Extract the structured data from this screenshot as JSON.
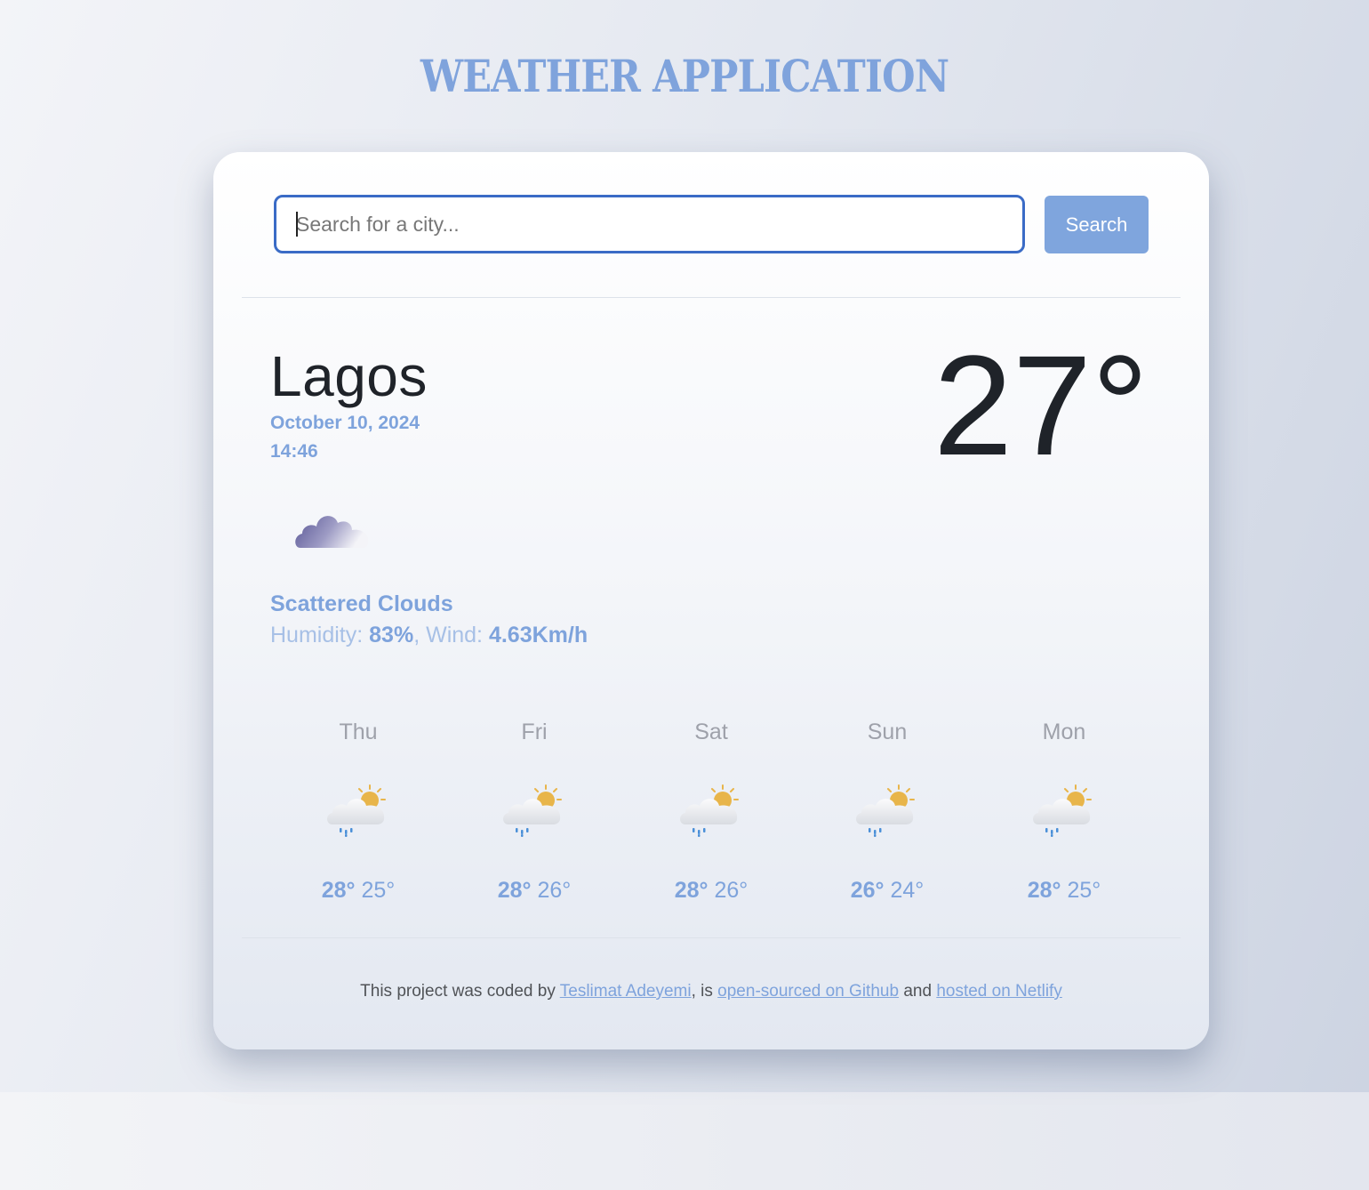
{
  "header": {
    "title": "WEATHER APPLICATION"
  },
  "search": {
    "placeholder": "Search for a city...",
    "value": "",
    "button_label": "Search"
  },
  "current": {
    "city": "Lagos",
    "date": "October 10, 2024",
    "time": "14:46",
    "temperature": "27°",
    "icon": "scattered-clouds-icon",
    "description": "Scattered Clouds",
    "humidity_label": "Humidity:",
    "humidity_value": "83%",
    "wind_label": "Wind:",
    "wind_value": "4.63Km/h"
  },
  "forecast": [
    {
      "day": "Thu",
      "icon": "sun-rain-cloud-icon",
      "max": "28°",
      "min": "25°"
    },
    {
      "day": "Fri",
      "icon": "sun-rain-cloud-icon",
      "max": "28°",
      "min": "26°"
    },
    {
      "day": "Sat",
      "icon": "sun-rain-cloud-icon",
      "max": "28°",
      "min": "26°"
    },
    {
      "day": "Sun",
      "icon": "sun-rain-cloud-icon",
      "max": "26°",
      "min": "24°"
    },
    {
      "day": "Mon",
      "icon": "sun-rain-cloud-icon",
      "max": "28°",
      "min": "25°"
    }
  ],
  "footer": {
    "text_1": "This project was coded by ",
    "author_link": "Teslimat Adeyemi",
    "text_2": ", is ",
    "github_link": "open-sourced on Github",
    "text_3": " and ",
    "netlify_link": "hosted on Netlify"
  },
  "colors": {
    "accent": "#7fa3dc",
    "input_border": "#3a6bc6",
    "text_dark": "#1f2329"
  }
}
